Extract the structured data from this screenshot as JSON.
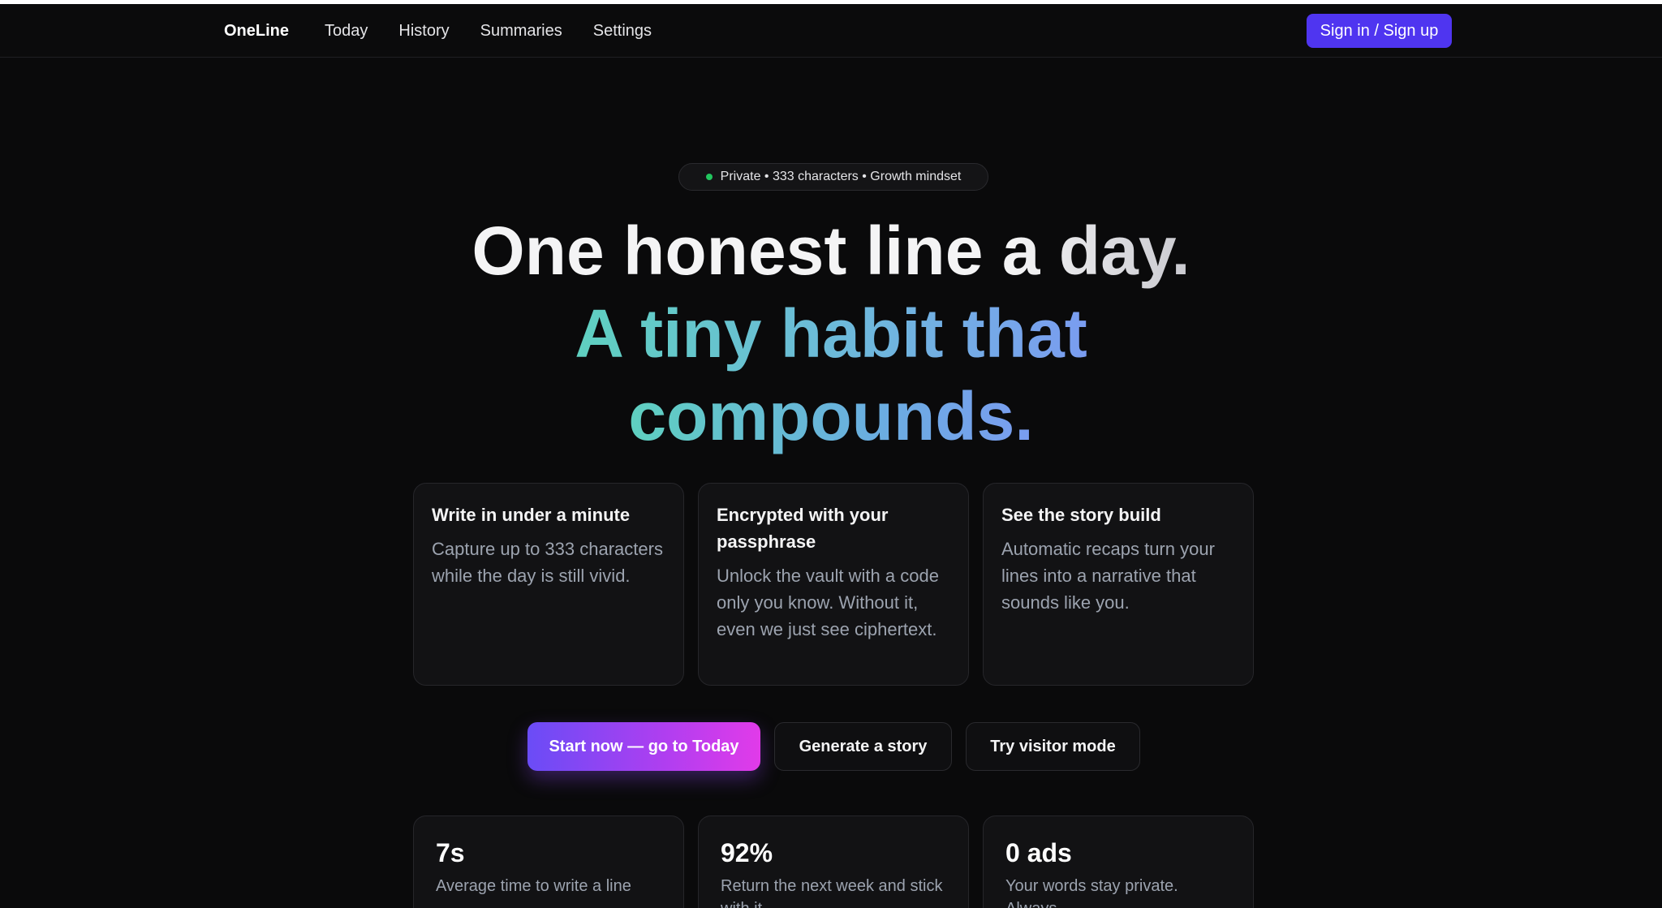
{
  "nav": {
    "brand": "OneLine",
    "links": [
      "Today",
      "History",
      "Summaries",
      "Settings"
    ],
    "signin_label": "Sign in / Sign up"
  },
  "hero": {
    "pill_text": "Private • 333 characters • Growth mindset",
    "headline_line1": "One honest line a day.",
    "headline_line2": "A tiny habit that",
    "headline_line3": "compounds."
  },
  "features": [
    {
      "title": "Write in under a minute",
      "body": "Capture up to 333 characters while the day is still vivid."
    },
    {
      "title": "Encrypted with your passphrase",
      "body": "Unlock the vault with a code only you know. Without it, even we just see ciphertext."
    },
    {
      "title": "See the story build",
      "body": "Automatic recaps turn your lines into a narrative that sounds like you."
    }
  ],
  "cta": {
    "primary_label": "Start now — go to Today",
    "story_label": "Generate a story",
    "visitor_label": "Try visitor mode"
  },
  "stats": [
    {
      "value": "7s",
      "label": "Average time to write a line"
    },
    {
      "value": "92%",
      "label": "Return the next week and stick with it"
    },
    {
      "value": "0 ads",
      "label": "Your words stay private. Always."
    }
  ],
  "colors": {
    "background": "#0a0a0b",
    "signin_button": "#4f35f0",
    "status_dot": "#22c55e",
    "gradient_start": "#5fd0c0",
    "gradient_end": "#7a9cf0",
    "cta_gradient_start": "#6a4cf6",
    "cta_gradient_end": "#e13be9"
  }
}
